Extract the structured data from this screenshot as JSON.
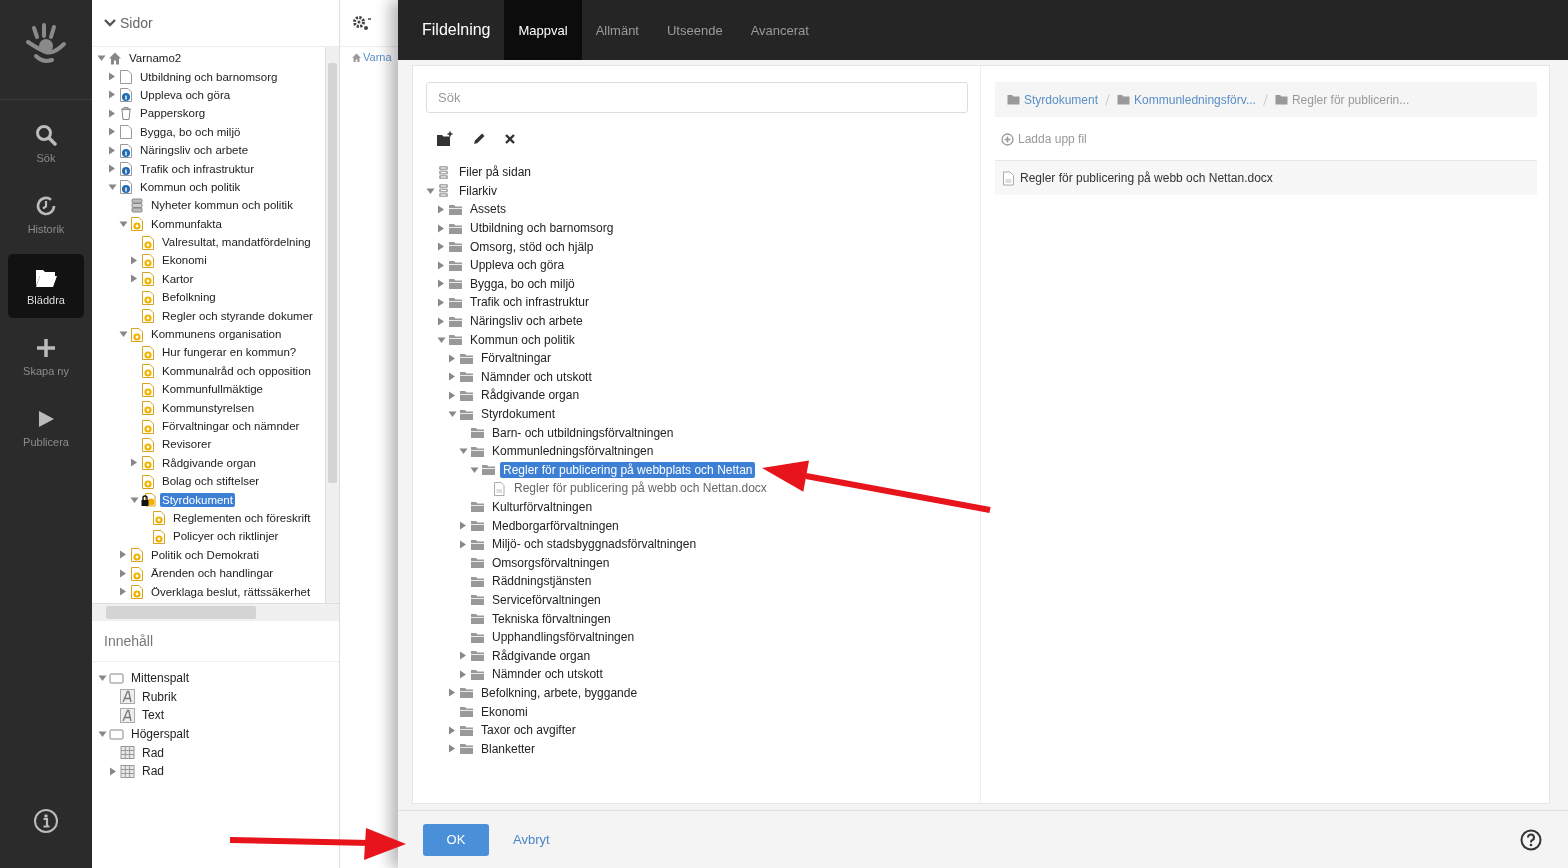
{
  "rail": {
    "items": [
      {
        "label": "Sök",
        "kind": "search",
        "selected": false
      },
      {
        "label": "Historik",
        "kind": "history",
        "selected": false
      },
      {
        "label": "Bläddra",
        "kind": "folder",
        "selected": true
      },
      {
        "label": "Skapa ny",
        "kind": "plus",
        "selected": false
      },
      {
        "label": "Publicera",
        "kind": "play",
        "selected": false
      }
    ]
  },
  "pages_panel": {
    "title": "Sidor",
    "tree": [
      {
        "label": "Varnamo2",
        "kind": "home",
        "expanded": true,
        "selected": false,
        "children": [
          {
            "label": "Utbildning och barnomsorg",
            "kind": "page",
            "expanded": false,
            "selected": false
          },
          {
            "label": "Uppleva och göra",
            "kind": "info",
            "expanded": false,
            "selected": false
          },
          {
            "label": "Papperskorg",
            "kind": "trash",
            "expanded": false,
            "selected": false
          },
          {
            "label": "Bygga, bo och miljö",
            "kind": "page",
            "expanded": false,
            "selected": false
          },
          {
            "label": "Näringsliv och arbete",
            "kind": "info",
            "expanded": false,
            "selected": false
          },
          {
            "label": "Trafik och infrastruktur",
            "kind": "info",
            "expanded": false,
            "selected": false
          },
          {
            "label": "Kommun och politik",
            "kind": "info",
            "expanded": true,
            "selected": false,
            "children": [
              {
                "label": "Nyheter kommun och politik",
                "kind": "news",
                "selected": false
              },
              {
                "label": "Kommunfakta",
                "kind": "badge",
                "expanded": true,
                "selected": false,
                "children": [
                  {
                    "label": "Valresultat, mandatfördelning",
                    "kind": "badge",
                    "selected": false
                  },
                  {
                    "label": "Ekonomi",
                    "kind": "badge",
                    "expanded": false,
                    "selected": false
                  },
                  {
                    "label": "Kartor",
                    "kind": "badge",
                    "expanded": false,
                    "selected": false
                  },
                  {
                    "label": "Befolkning",
                    "kind": "badge",
                    "selected": false
                  },
                  {
                    "label": "Regler och styrande dokumer",
                    "kind": "badge",
                    "selected": false
                  }
                ]
              },
              {
                "label": "Kommunens organisation",
                "kind": "badge",
                "expanded": true,
                "selected": false,
                "children": [
                  {
                    "label": "Hur fungerar en kommun?",
                    "kind": "badge",
                    "selected": false
                  },
                  {
                    "label": "Kommunalråd och opposition",
                    "kind": "badge",
                    "selected": false
                  },
                  {
                    "label": "Kommunfullmäktige",
                    "kind": "badge",
                    "selected": false
                  },
                  {
                    "label": "Kommunstyrelsen",
                    "kind": "badge",
                    "selected": false
                  },
                  {
                    "label": "Förvaltningar och nämnder",
                    "kind": "badge",
                    "selected": false
                  },
                  {
                    "label": "Revisorer",
                    "kind": "badge",
                    "selected": false
                  },
                  {
                    "label": "Rådgivande organ",
                    "kind": "badge",
                    "expanded": false,
                    "selected": false
                  },
                  {
                    "label": "Bolag och stiftelser",
                    "kind": "badge",
                    "selected": false
                  },
                  {
                    "label": "Styrdokument",
                    "kind": "locked",
                    "expanded": true,
                    "selected": true,
                    "children": [
                      {
                        "label": "Reglementen och föreskrift",
                        "kind": "badge",
                        "selected": false
                      },
                      {
                        "label": "Policyer och riktlinjer",
                        "kind": "badge",
                        "selected": false
                      }
                    ]
                  }
                ]
              },
              {
                "label": "Politik och Demokrati",
                "kind": "badge",
                "expanded": false,
                "selected": false
              },
              {
                "label": "Ärenden och handlingar",
                "kind": "badge",
                "expanded": false,
                "selected": false
              },
              {
                "label": "Överklaga beslut, rättssäkerhet",
                "kind": "badge",
                "expanded": false,
                "selected": false
              }
            ]
          }
        ]
      }
    ]
  },
  "content_panel": {
    "title": "Innehåll",
    "tree": [
      {
        "label": "Mittenspalt",
        "kind": "frame",
        "expanded": true,
        "selected": false,
        "children": [
          {
            "label": "Rubrik",
            "kind": "text",
            "selected": false
          },
          {
            "label": "Text",
            "kind": "text",
            "selected": false
          }
        ]
      },
      {
        "label": "Högerspalt",
        "kind": "frame",
        "expanded": true,
        "selected": false,
        "children": [
          {
            "label": "Rad",
            "kind": "grid",
            "selected": false
          },
          {
            "label": "Rad",
            "kind": "grid",
            "expanded": false,
            "selected": false
          }
        ]
      }
    ]
  },
  "page_toolbar": {
    "breadcrumb": "Varna"
  },
  "dialog": {
    "title": "Fildelning",
    "tabs": [
      {
        "label": "Mappval",
        "selected": true
      },
      {
        "label": "Allmänt",
        "selected": false
      },
      {
        "label": "Utseende",
        "selected": false
      },
      {
        "label": "Avancerat",
        "selected": false
      }
    ],
    "search": {
      "placeholder": "Sök"
    },
    "tree": [
      {
        "label": "Filer på sidan",
        "kind": "database",
        "selected": false
      },
      {
        "label": "Filarkiv",
        "kind": "database",
        "expanded": true,
        "selected": false,
        "children": [
          {
            "label": "Assets",
            "kind": "folder",
            "expanded": false,
            "selected": false
          },
          {
            "label": "Utbildning och barnomsorg",
            "kind": "folder",
            "expanded": false,
            "selected": false
          },
          {
            "label": "Omsorg, stöd och hjälp",
            "kind": "folder",
            "expanded": false,
            "selected": false
          },
          {
            "label": "Uppleva och göra",
            "kind": "folder",
            "expanded": false,
            "selected": false
          },
          {
            "label": "Bygga, bo och miljö",
            "kind": "folder",
            "expanded": false,
            "selected": false
          },
          {
            "label": "Trafik och infrastruktur",
            "kind": "folder",
            "expanded": false,
            "selected": false
          },
          {
            "label": "Näringsliv och arbete",
            "kind": "folder",
            "expanded": false,
            "selected": false
          },
          {
            "label": "Kommun och politik",
            "kind": "folder",
            "expanded": true,
            "selected": false,
            "children": [
              {
                "label": "Förvaltningar",
                "kind": "folder",
                "expanded": false,
                "selected": false
              },
              {
                "label": "Nämnder och utskott",
                "kind": "folder",
                "expanded": false,
                "selected": false
              },
              {
                "label": "Rådgivande organ",
                "kind": "folder",
                "expanded": false,
                "selected": false
              },
              {
                "label": "Styrdokument",
                "kind": "folder",
                "expanded": true,
                "selected": false,
                "children": [
                  {
                    "label": "Barn- och utbildningsförvaltningen",
                    "kind": "folder",
                    "selected": false
                  },
                  {
                    "label": "Kommunledningsförvaltningen",
                    "kind": "folder",
                    "expanded": true,
                    "selected": false,
                    "children": [
                      {
                        "label": "Regler för publicering på webbplats och Nettan",
                        "kind": "folder",
                        "expanded": true,
                        "selected": true,
                        "children": [
                          {
                            "label": "Regler för publicering på webb och Nettan.docx",
                            "kind": "file",
                            "selected": false
                          }
                        ]
                      }
                    ]
                  },
                  {
                    "label": "Kulturförvaltningen",
                    "kind": "folder",
                    "selected": false
                  },
                  {
                    "label": "Medborgarförvaltningen",
                    "kind": "folder",
                    "expanded": false,
                    "selected": false
                  },
                  {
                    "label": "Miljö- och stadsbyggnadsförvaltningen",
                    "kind": "folder",
                    "expanded": false,
                    "selected": false
                  },
                  {
                    "label": "Omsorgsförvaltningen",
                    "kind": "folder",
                    "selected": false
                  },
                  {
                    "label": "Räddningstjänsten",
                    "kind": "folder",
                    "selected": false
                  },
                  {
                    "label": "Serviceförvaltningen",
                    "kind": "folder",
                    "selected": false
                  },
                  {
                    "label": "Tekniska förvaltningen",
                    "kind": "folder",
                    "selected": false
                  },
                  {
                    "label": "Upphandlingsförvaltningen",
                    "kind": "folder",
                    "selected": false
                  },
                  {
                    "label": "Rådgivande organ",
                    "kind": "folder",
                    "expanded": false,
                    "selected": false
                  },
                  {
                    "label": "Nämnder och utskott",
                    "kind": "folder",
                    "expanded": false,
                    "selected": false
                  }
                ]
              },
              {
                "label": "Befolkning, arbete, byggande",
                "kind": "folder",
                "expanded": false,
                "selected": false
              },
              {
                "label": "Ekonomi",
                "kind": "folder",
                "selected": false
              },
              {
                "label": "Taxor och avgifter",
                "kind": "folder",
                "expanded": false,
                "selected": false
              },
              {
                "label": "Blanketter",
                "kind": "folder",
                "expanded": false,
                "selected": false
              }
            ]
          }
        ]
      }
    ],
    "breadcrumb": [
      {
        "label": "Styrdokument",
        "link": true
      },
      {
        "label": "Kommunledningsförv...",
        "link": true
      },
      {
        "label": "Regler för publicerin...",
        "link": false
      }
    ],
    "upload": "Ladda upp fil",
    "files": [
      {
        "name": "Regler för publicering på webb och Nettan.docx"
      }
    ],
    "buttons": [
      {
        "label": "OK",
        "kind": "primary"
      },
      {
        "label": "Avbryt",
        "kind": "link"
      }
    ]
  }
}
